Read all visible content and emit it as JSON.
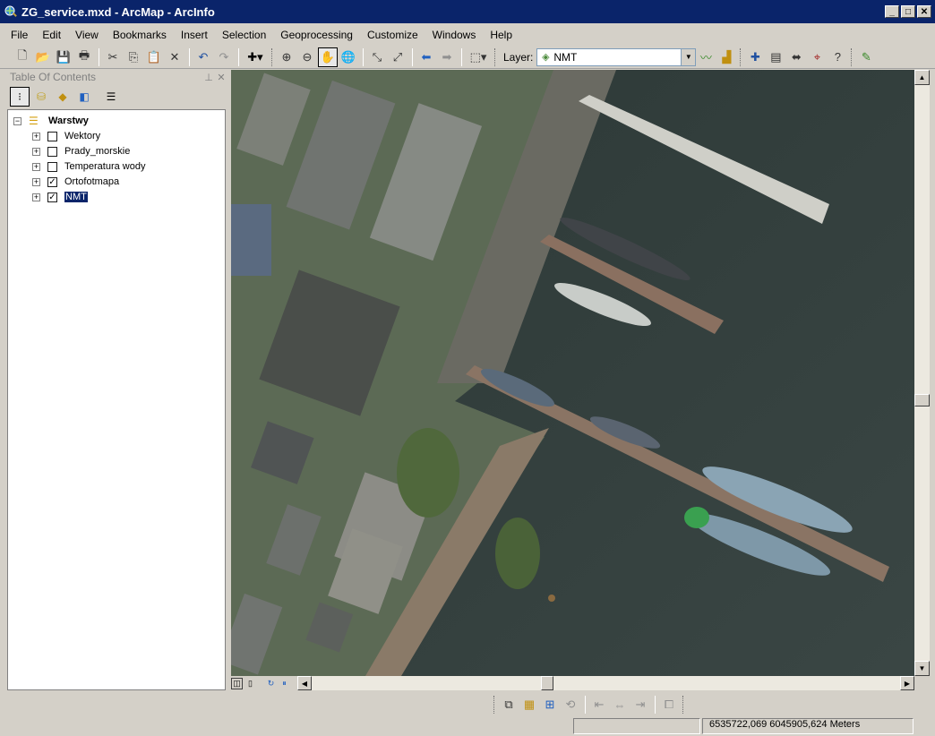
{
  "window": {
    "title": "ZG_service.mxd - ArcMap - ArcInfo",
    "minimize": "_",
    "maximize": "□",
    "close": "✕"
  },
  "menu": {
    "items": [
      "File",
      "Edit",
      "View",
      "Bookmarks",
      "Insert",
      "Selection",
      "Geoprocessing",
      "Customize",
      "Windows",
      "Help"
    ]
  },
  "toolbar": {
    "layer_label": "Layer:",
    "layer_value": "NMT"
  },
  "toc": {
    "title": "Table Of Contents",
    "group": {
      "label": "Warstwy",
      "expander": "−"
    },
    "layers": [
      {
        "label": "Wektory",
        "checked": false
      },
      {
        "label": "Prady_morskie",
        "checked": false
      },
      {
        "label": "Temperatura wody",
        "checked": false
      },
      {
        "label": "Ortofotmapa",
        "checked": true
      },
      {
        "label": "NMT",
        "checked": true
      }
    ]
  },
  "status": {
    "coordinates": "6535722,069  6045905,624 Meters"
  },
  "colors": {
    "titlebar": "#0a246a",
    "chrome": "#d4d0c8",
    "water": "#2e3a38"
  }
}
